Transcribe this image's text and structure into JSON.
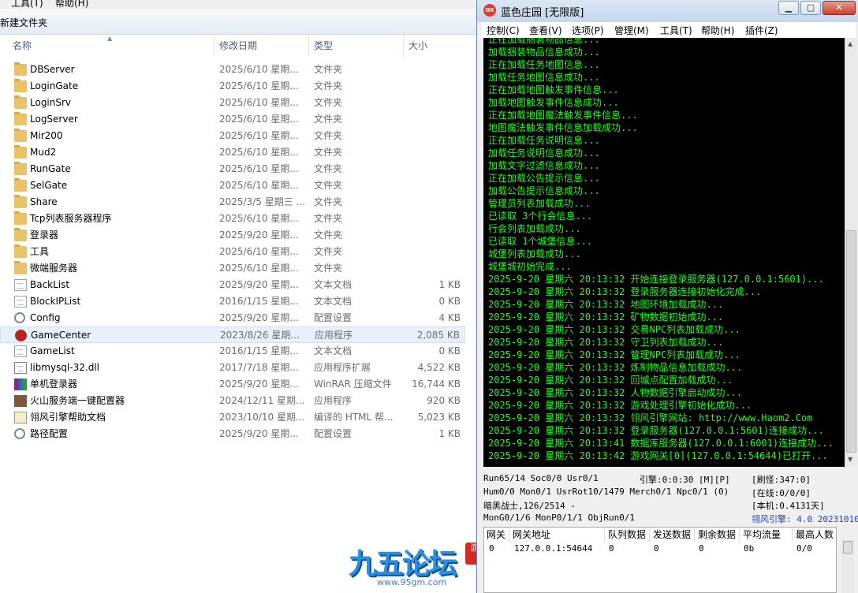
{
  "explorer": {
    "menu": [
      "工具(T)",
      "帮助(H)"
    ],
    "toolbar": {
      "new_folder": "新建文件夹"
    },
    "columns": {
      "name": "名称",
      "date": "修改日期",
      "type": "类型",
      "size": "大小"
    },
    "files": [
      {
        "name": "DBServer",
        "date": "2025/6/10 星期...",
        "type": "文件夹",
        "size": "",
        "icon": "folder-icon"
      },
      {
        "name": "LoginGate",
        "date": "2025/6/10 星期...",
        "type": "文件夹",
        "size": "",
        "icon": "folder-icon"
      },
      {
        "name": "LoginSrv",
        "date": "2025/6/10 星期...",
        "type": "文件夹",
        "size": "",
        "icon": "folder-icon"
      },
      {
        "name": "LogServer",
        "date": "2025/6/10 星期...",
        "type": "文件夹",
        "size": "",
        "icon": "folder-icon"
      },
      {
        "name": "Mir200",
        "date": "2025/6/10 星期...",
        "type": "文件夹",
        "size": "",
        "icon": "folder-icon"
      },
      {
        "name": "Mud2",
        "date": "2025/6/10 星期...",
        "type": "文件夹",
        "size": "",
        "icon": "folder-icon"
      },
      {
        "name": "RunGate",
        "date": "2025/6/10 星期...",
        "type": "文件夹",
        "size": "",
        "icon": "folder-icon"
      },
      {
        "name": "SelGate",
        "date": "2025/6/10 星期...",
        "type": "文件夹",
        "size": "",
        "icon": "folder-icon"
      },
      {
        "name": "Share",
        "date": "2025/3/5 星期三 ...",
        "type": "文件夹",
        "size": "",
        "icon": "folder-icon"
      },
      {
        "name": "Tcp列表服务器程序",
        "date": "2025/6/10 星期...",
        "type": "文件夹",
        "size": "",
        "icon": "folder-icon"
      },
      {
        "name": "登录器",
        "date": "2025/9/20 星期...",
        "type": "文件夹",
        "size": "",
        "icon": "folder-icon"
      },
      {
        "name": "工具",
        "date": "2025/6/10 星期...",
        "type": "文件夹",
        "size": "",
        "icon": "folder-icon"
      },
      {
        "name": "微端服务器",
        "date": "2025/6/10 星期...",
        "type": "文件夹",
        "size": "",
        "icon": "folder-icon"
      },
      {
        "name": "BackList",
        "date": "2025/9/20 星期...",
        "type": "文本文档",
        "size": "1 KB",
        "icon": "text-file-icon"
      },
      {
        "name": "BlockIPList",
        "date": "2016/1/15 星期...",
        "type": "文本文档",
        "size": "0 KB",
        "icon": "text-file-icon"
      },
      {
        "name": "Config",
        "date": "2025/9/20 星期...",
        "type": "配置设置",
        "size": "4 KB",
        "icon": "config-file-icon"
      },
      {
        "name": "GameCenter",
        "date": "2023/8/26 星期...",
        "type": "应用程序",
        "size": "2,085 KB",
        "icon": "gamecenter-app-icon"
      },
      {
        "name": "GameList",
        "date": "2016/1/15 星期...",
        "type": "文本文档",
        "size": "0 KB",
        "icon": "text-file-icon"
      },
      {
        "name": "libmysql-32.dll",
        "date": "2017/7/18 星期...",
        "type": "应用程序扩展",
        "size": "4,522 KB",
        "icon": "dll-file-icon"
      },
      {
        "name": "单机登录器",
        "date": "2025/9/20 星期...",
        "type": "WinRAR 压缩文件",
        "size": "16,744 KB",
        "icon": "winrar-archive-icon"
      },
      {
        "name": "火山服务端一键配置器",
        "date": "2024/12/11 星期...",
        "type": "应用程序",
        "size": "920 KB",
        "icon": "configurator-app-icon"
      },
      {
        "name": "翎风引擎帮助文档",
        "date": "2023/10/10 星期...",
        "type": "编译的 HTML 帮...",
        "size": "5,023 KB",
        "icon": "help-file-icon"
      },
      {
        "name": "路径配置",
        "date": "2025/9/20 星期...",
        "type": "配置设置",
        "size": "1 KB",
        "icon": "config-file-icon"
      }
    ],
    "selected_index": 16
  },
  "watermark": {
    "logo": "九五论坛",
    "url": "www.95gm.com",
    "seal": "游"
  },
  "app": {
    "title": "蓝色庄园 [无限版]",
    "icon_text": "OX",
    "menu": [
      "控制(C)",
      "查看(V)",
      "选项(P)",
      "管理(M)",
      "工具(T)",
      "帮助(H)",
      "插件(Z)"
    ],
    "console_lines": [
      "正在加载捆装物品信息...",
      "加载捆装物品信息成功...",
      "正在加载任务地图信息...",
      "加载任务地图信息成功...",
      "正在加载地图触发事件信息...",
      "加载地图触发事件信息成功...",
      "正在加载地图魔法触发事件信息...",
      "地图魔法触发事件信息加载成功...",
      "正在加载任务说明信息...",
      "加载任务说明信息成功...",
      "加载文字过滤信息成功...",
      "正在加载公告提示信息...",
      "加载公告提示信息成功...",
      "管理员列表加载成功...",
      "已读取 3个行会信息...",
      "行会列表加载成功...",
      "已读取 1个城堡信息...",
      "城堡列表加载成功...",
      "城堡城初始完成...",
      "2025-9-20 星期六 20:13:32 开始连接登录服务器(127.0.0.1:5601)...",
      "2025-9-20 星期六 20:13:32 登录服务器连接初始化完成...",
      "2025-9-20 星期六 20:13:32 地图环境加载成功...",
      "2025-9-20 星期六 20:13:32 矿物数据初始成功...",
      "2025-9-20 星期六 20:13:32 交易NPC列表加载成功...",
      "2025-9-20 星期六 20:13:32 守卫列表加载成功...",
      "2025-9-20 星期六 20:13:32 管理NPC列表加载成功...",
      "2025-9-20 星期六 20:13:32 炼制物品信息加载成功...",
      "2025-9-20 星期六 20:13:32 回城点配置加载成功...",
      "2025-9-20 星期六 20:13:32 人物数据引擎启动成功...",
      "2025-9-20 星期六 20:13:32 游戏处理引擎初始化成功...",
      "2025-9-20 星期六 20:13:32 翎风引擎网站: http://www.Haom2.Com",
      "2025-9-20 星期六 20:13:32 登录服务器(127.0.0.1:5601)连接成功...",
      "2025-9-20 星期六 20:13:41 数据库服务器(127.0.0.1:6001)连接成功...",
      "2025-9-20 星期六 20:13:42 游戏网关[0](127.0.0.1:54644)已打开..."
    ],
    "status": {
      "line1_left": "Run65/14 Soc0/0 Usr0/1",
      "line1_mid": "引擎:0:0:30 [M][P]",
      "line1_right": "[刷怪:347:0]",
      "line2_left": "Hum0/0 Mon0/1 UsrRot10/1479 Merch0/1 Npc0/1 (0)",
      "line2_right": "[在线:0/0/0]",
      "line3_left": "暗黑战士,126/2514 -",
      "line3_right": "[本机:0.4131天]",
      "line4_left": "MonG0/1/6 MonP0/1/1 ObjRun0/1",
      "line4_right": "翎风引擎: 4.0 20231010"
    },
    "gateway": {
      "headers": [
        "网关",
        "网关地址",
        "队列数据",
        "发送数据",
        "剩余数据",
        "平均流量",
        "最高人数"
      ],
      "row": [
        "0",
        "127.0.0.1:54644",
        "0",
        "0",
        "0",
        "0b",
        "0/0"
      ]
    },
    "colors": {
      "console_bg": "#000000",
      "console_text": "#1cff1c",
      "engine_version": "#1f3fbf"
    }
  }
}
